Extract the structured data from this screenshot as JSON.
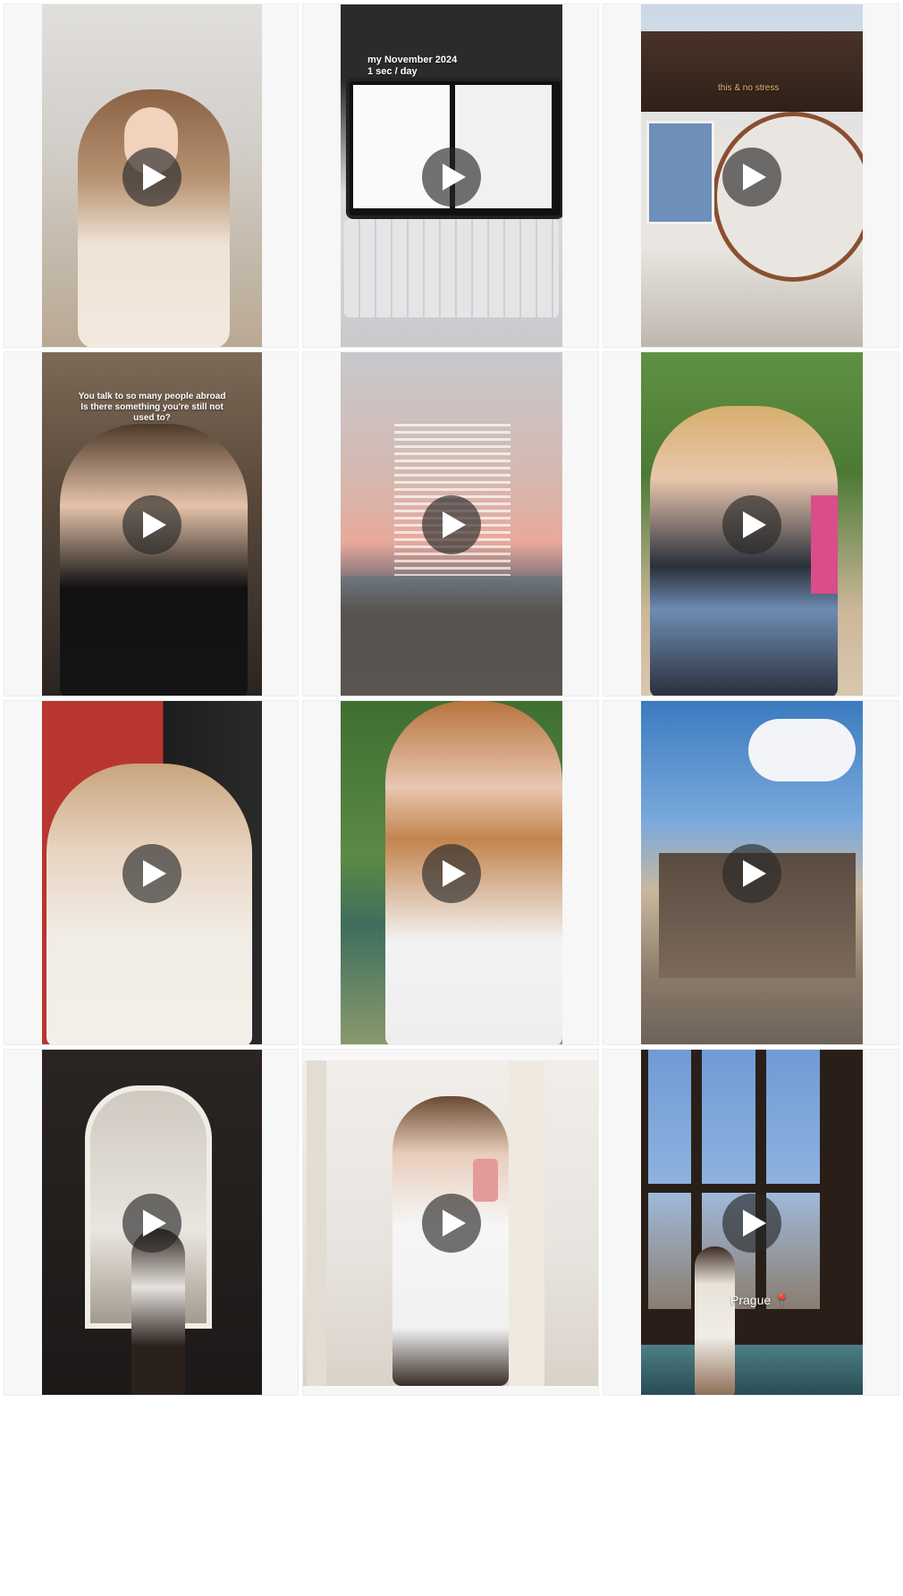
{
  "grid": {
    "columns": 3,
    "rows": 4
  },
  "tiles": [
    {
      "id": "tile-1",
      "caption": "",
      "icon": "play-icon",
      "colors": [
        "#d9d6d2",
        "#b89a7a",
        "#7a5a3c"
      ]
    },
    {
      "id": "tile-2",
      "caption_line1": "my November 2024",
      "caption_line2": "1 sec / day",
      "icon": "play-icon",
      "colors": [
        "#2a2a2a",
        "#e9e9ea",
        "#cfcfd2"
      ]
    },
    {
      "id": "tile-3",
      "caption": "this & no stress",
      "icon": "play-icon",
      "colors": [
        "#cfd9e6",
        "#5a3b2b",
        "#e7e3df"
      ]
    },
    {
      "id": "tile-4",
      "caption_line1": "You talk to so many people abroad",
      "caption_line2": "Is there something you're still not",
      "caption_line3": "used to?",
      "icon": "play-icon",
      "colors": [
        "#5c4b3d",
        "#1e1e1e",
        "#cdb49d"
      ]
    },
    {
      "id": "tile-5",
      "caption": "",
      "icon": "play-icon",
      "colors": [
        "#c9c9cd",
        "#e6b3a3",
        "#3b3d46"
      ]
    },
    {
      "id": "tile-6",
      "caption": "",
      "icon": "play-icon",
      "colors": [
        "#5c8a3c",
        "#d8b07a",
        "#2f3b56"
      ]
    },
    {
      "id": "tile-7",
      "caption": "",
      "icon": "play-icon",
      "colors": [
        "#b93a33",
        "#e4d2bd",
        "#2a2a2a"
      ]
    },
    {
      "id": "tile-8",
      "caption": "",
      "icon": "play-icon",
      "colors": [
        "#4b7a3a",
        "#c58654",
        "#f1f1f1"
      ]
    },
    {
      "id": "tile-9",
      "caption": "",
      "icon": "play-icon",
      "colors": [
        "#3f7fc2",
        "#b9a58a",
        "#6c6057"
      ]
    },
    {
      "id": "tile-10",
      "caption": "",
      "icon": "play-icon",
      "colors": [
        "#1f1c1b",
        "#d8d2c8",
        "#5a4e46"
      ]
    },
    {
      "id": "tile-11",
      "caption": "",
      "icon": "play-icon",
      "colors": [
        "#ece9e5",
        "#f5f5f5",
        "#8a6c54"
      ]
    },
    {
      "id": "tile-12",
      "caption": "Prague 📍",
      "icon": "play-icon",
      "colors": [
        "#7fa6d9",
        "#3b2b22",
        "#a8a29a"
      ]
    }
  ]
}
